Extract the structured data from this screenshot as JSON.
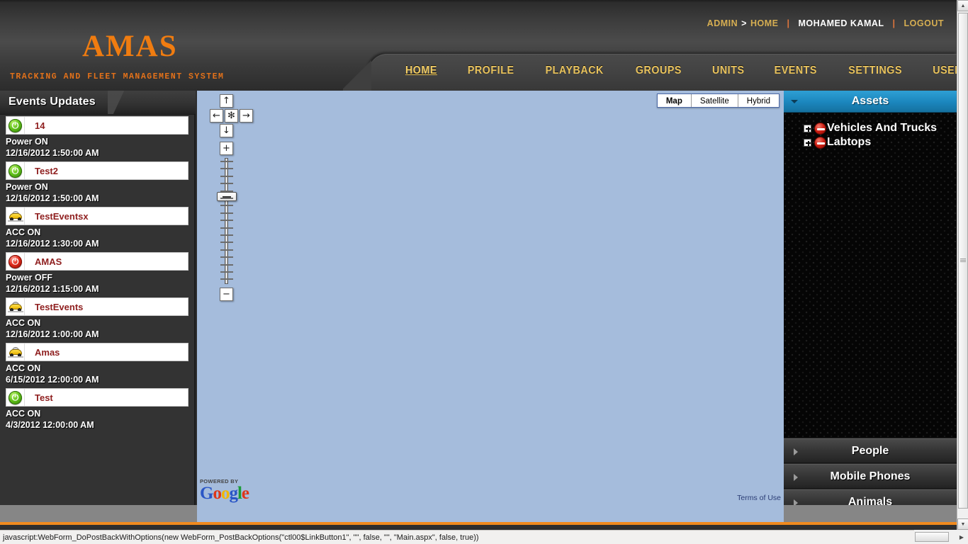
{
  "brand": {
    "logo": "AMAS",
    "tagline": "TRACKING AND FLEET MANAGEMENT SYSTEM"
  },
  "userbar": {
    "breadcrumb_root": "ADMIN",
    "breadcrumb_arrow": ">",
    "breadcrumb_current": "HOME",
    "separator": "|",
    "username": "MOHAMED KAMAL",
    "logout": "LOGOUT"
  },
  "nav": {
    "items": [
      {
        "label": "HOME",
        "active": true
      },
      {
        "label": "PROFILE",
        "active": false
      },
      {
        "label": "PLAYBACK",
        "active": false
      },
      {
        "label": "GROUPS",
        "active": false
      },
      {
        "label": "UNITS",
        "active": false
      },
      {
        "label": "EVENTS",
        "active": false
      },
      {
        "label": "SETTINGS",
        "active": false
      },
      {
        "label": "USERS",
        "active": false
      }
    ]
  },
  "events_panel": {
    "title": "Events Updates",
    "items": [
      {
        "icon": "power-on-icon",
        "name": "14",
        "status": "Power ON",
        "time": "12/16/2012 1:50:00 AM"
      },
      {
        "icon": "power-on-icon",
        "name": "Test2",
        "status": "Power ON",
        "time": "12/16/2012 1:50:00 AM"
      },
      {
        "icon": "car-icon",
        "name": "TestEventsx",
        "status": "ACC ON",
        "time": "12/16/2012 1:30:00 AM"
      },
      {
        "icon": "power-off-icon",
        "name": "AMAS",
        "status": "Power OFF",
        "time": "12/16/2012 1:15:00 AM"
      },
      {
        "icon": "car-icon",
        "name": "TestEvents",
        "status": "ACC ON",
        "time": "12/16/2012 1:00:00 AM"
      },
      {
        "icon": "car-icon",
        "name": "Amas",
        "status": "ACC ON",
        "time": "6/15/2012 12:00:00 AM"
      },
      {
        "icon": "power-on-icon",
        "name": "Test",
        "status": "ACC ON",
        "time": "4/3/2012 12:00:00 AM"
      }
    ]
  },
  "map": {
    "types": [
      {
        "label": "Map",
        "active": true
      },
      {
        "label": "Satellite",
        "active": false
      },
      {
        "label": "Hybrid",
        "active": false
      }
    ],
    "controls": {
      "pan_up": "↑",
      "pan_left": "←",
      "pan_center": "✻",
      "pan_right": "→",
      "pan_down": "↓",
      "zoom_in": "+",
      "zoom_out": "−"
    },
    "attribution": {
      "powered_by": "POWERED BY",
      "google": [
        "G",
        "o",
        "o",
        "g",
        "l",
        "e"
      ],
      "terms": "Terms of Use"
    },
    "background_color": "#a5bcdc"
  },
  "assets_panel": {
    "title": "Assets",
    "header_color": "#1b86bd",
    "tree": [
      {
        "label": "Vehicles And Trucks",
        "expander": "plus-icon",
        "status_icon": "no-entry-icon"
      },
      {
        "label": "Labtops",
        "expander": "plus-icon",
        "status_icon": "no-entry-icon"
      }
    ],
    "accordions": [
      {
        "label": "People"
      },
      {
        "label": "Mobile Phones"
      },
      {
        "label": "Animals"
      }
    ]
  },
  "statusbar": {
    "text": "javascript:WebForm_DoPostBackWithOptions(new WebForm_PostBackOptions(\"ctl00$LinkButton1\", \"\", false, \"\", \"Main.aspx\", false, true))"
  },
  "scrollbars": {
    "up_arrow": "▲",
    "down_arrow": "▼",
    "right_arrow": "▶"
  },
  "colors": {
    "accent_orange": "#f07c10",
    "nav_gold": "#e8c25c",
    "panel_dark": "#333333",
    "assets_blue": "#1b86bd"
  }
}
